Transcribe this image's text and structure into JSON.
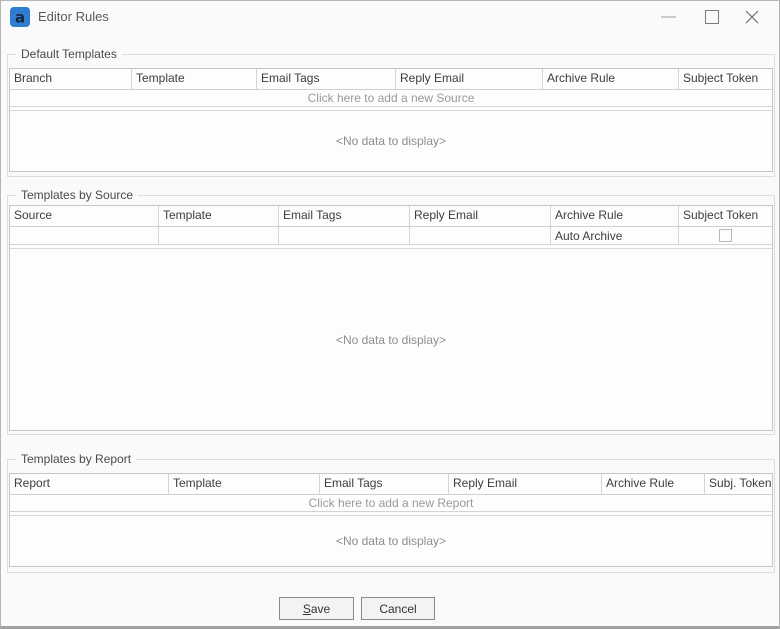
{
  "window": {
    "title": "Editor Rules"
  },
  "titlebar": {
    "icons": {
      "app": "app-logo-icon",
      "minimize": "minimize-icon",
      "maximize": "maximize-icon",
      "close": "close-icon"
    }
  },
  "colors": {
    "app_icon_blue": "#2f7dd1",
    "app_icon_glyph": "#14283c",
    "window_border": "#b5b5b5",
    "window_bottom_border": "#a2a2a2",
    "grid_border": "#c6c6c6",
    "cell_border": "#d4d4d4",
    "muted_text": "#9a9a9a",
    "header_text": "#3d3d3d"
  },
  "groups": [
    {
      "title": "Default Templates",
      "columns": [
        "Branch",
        "Template",
        "Email Tags",
        "Reply Email",
        "Archive Rule",
        "Subject Token"
      ],
      "add_row_text": "Click here to add a new Source",
      "empty_text": "<No data to display>"
    },
    {
      "title": "Templates by Source",
      "columns": [
        "Source",
        "Template",
        "Email Tags",
        "Reply Email",
        "Archive Rule",
        "Subject Token"
      ],
      "row": {
        "source": "",
        "template": "",
        "email_tags": "",
        "reply_email": "",
        "archive_rule": "Auto Archive",
        "subject_token_checked": false
      },
      "empty_text": "<No data to display>"
    },
    {
      "title": "Templates by Report",
      "columns": [
        "Report",
        "Template",
        "Email Tags",
        "Reply Email",
        "Archive Rule",
        "Subj. Token"
      ],
      "add_row_text": "Click here to add a new Report",
      "empty_text": "<No data to display>"
    }
  ],
  "buttons": {
    "save": "Save",
    "cancel": "Cancel"
  }
}
